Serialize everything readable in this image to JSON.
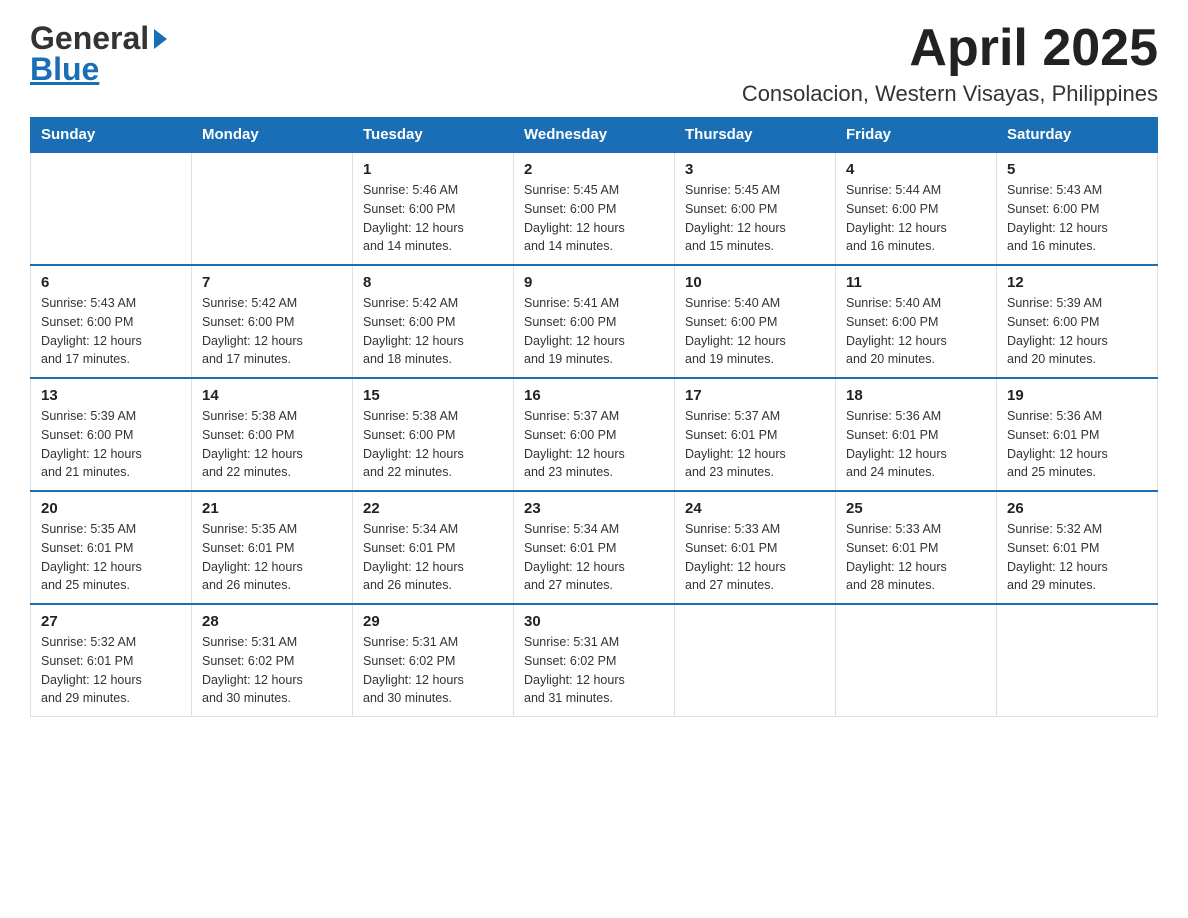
{
  "header": {
    "logo_general": "General",
    "logo_blue": "Blue",
    "month_title": "April 2025",
    "subtitle": "Consolacion, Western Visayas, Philippines"
  },
  "weekdays": [
    "Sunday",
    "Monday",
    "Tuesday",
    "Wednesday",
    "Thursday",
    "Friday",
    "Saturday"
  ],
  "weeks": [
    [
      {
        "day": "",
        "info": ""
      },
      {
        "day": "",
        "info": ""
      },
      {
        "day": "1",
        "info": "Sunrise: 5:46 AM\nSunset: 6:00 PM\nDaylight: 12 hours\nand 14 minutes."
      },
      {
        "day": "2",
        "info": "Sunrise: 5:45 AM\nSunset: 6:00 PM\nDaylight: 12 hours\nand 14 minutes."
      },
      {
        "day": "3",
        "info": "Sunrise: 5:45 AM\nSunset: 6:00 PM\nDaylight: 12 hours\nand 15 minutes."
      },
      {
        "day": "4",
        "info": "Sunrise: 5:44 AM\nSunset: 6:00 PM\nDaylight: 12 hours\nand 16 minutes."
      },
      {
        "day": "5",
        "info": "Sunrise: 5:43 AM\nSunset: 6:00 PM\nDaylight: 12 hours\nand 16 minutes."
      }
    ],
    [
      {
        "day": "6",
        "info": "Sunrise: 5:43 AM\nSunset: 6:00 PM\nDaylight: 12 hours\nand 17 minutes."
      },
      {
        "day": "7",
        "info": "Sunrise: 5:42 AM\nSunset: 6:00 PM\nDaylight: 12 hours\nand 17 minutes."
      },
      {
        "day": "8",
        "info": "Sunrise: 5:42 AM\nSunset: 6:00 PM\nDaylight: 12 hours\nand 18 minutes."
      },
      {
        "day": "9",
        "info": "Sunrise: 5:41 AM\nSunset: 6:00 PM\nDaylight: 12 hours\nand 19 minutes."
      },
      {
        "day": "10",
        "info": "Sunrise: 5:40 AM\nSunset: 6:00 PM\nDaylight: 12 hours\nand 19 minutes."
      },
      {
        "day": "11",
        "info": "Sunrise: 5:40 AM\nSunset: 6:00 PM\nDaylight: 12 hours\nand 20 minutes."
      },
      {
        "day": "12",
        "info": "Sunrise: 5:39 AM\nSunset: 6:00 PM\nDaylight: 12 hours\nand 20 minutes."
      }
    ],
    [
      {
        "day": "13",
        "info": "Sunrise: 5:39 AM\nSunset: 6:00 PM\nDaylight: 12 hours\nand 21 minutes."
      },
      {
        "day": "14",
        "info": "Sunrise: 5:38 AM\nSunset: 6:00 PM\nDaylight: 12 hours\nand 22 minutes."
      },
      {
        "day": "15",
        "info": "Sunrise: 5:38 AM\nSunset: 6:00 PM\nDaylight: 12 hours\nand 22 minutes."
      },
      {
        "day": "16",
        "info": "Sunrise: 5:37 AM\nSunset: 6:00 PM\nDaylight: 12 hours\nand 23 minutes."
      },
      {
        "day": "17",
        "info": "Sunrise: 5:37 AM\nSunset: 6:01 PM\nDaylight: 12 hours\nand 23 minutes."
      },
      {
        "day": "18",
        "info": "Sunrise: 5:36 AM\nSunset: 6:01 PM\nDaylight: 12 hours\nand 24 minutes."
      },
      {
        "day": "19",
        "info": "Sunrise: 5:36 AM\nSunset: 6:01 PM\nDaylight: 12 hours\nand 25 minutes."
      }
    ],
    [
      {
        "day": "20",
        "info": "Sunrise: 5:35 AM\nSunset: 6:01 PM\nDaylight: 12 hours\nand 25 minutes."
      },
      {
        "day": "21",
        "info": "Sunrise: 5:35 AM\nSunset: 6:01 PM\nDaylight: 12 hours\nand 26 minutes."
      },
      {
        "day": "22",
        "info": "Sunrise: 5:34 AM\nSunset: 6:01 PM\nDaylight: 12 hours\nand 26 minutes."
      },
      {
        "day": "23",
        "info": "Sunrise: 5:34 AM\nSunset: 6:01 PM\nDaylight: 12 hours\nand 27 minutes."
      },
      {
        "day": "24",
        "info": "Sunrise: 5:33 AM\nSunset: 6:01 PM\nDaylight: 12 hours\nand 27 minutes."
      },
      {
        "day": "25",
        "info": "Sunrise: 5:33 AM\nSunset: 6:01 PM\nDaylight: 12 hours\nand 28 minutes."
      },
      {
        "day": "26",
        "info": "Sunrise: 5:32 AM\nSunset: 6:01 PM\nDaylight: 12 hours\nand 29 minutes."
      }
    ],
    [
      {
        "day": "27",
        "info": "Sunrise: 5:32 AM\nSunset: 6:01 PM\nDaylight: 12 hours\nand 29 minutes."
      },
      {
        "day": "28",
        "info": "Sunrise: 5:31 AM\nSunset: 6:02 PM\nDaylight: 12 hours\nand 30 minutes."
      },
      {
        "day": "29",
        "info": "Sunrise: 5:31 AM\nSunset: 6:02 PM\nDaylight: 12 hours\nand 30 minutes."
      },
      {
        "day": "30",
        "info": "Sunrise: 5:31 AM\nSunset: 6:02 PM\nDaylight: 12 hours\nand 31 minutes."
      },
      {
        "day": "",
        "info": ""
      },
      {
        "day": "",
        "info": ""
      },
      {
        "day": "",
        "info": ""
      }
    ]
  ]
}
